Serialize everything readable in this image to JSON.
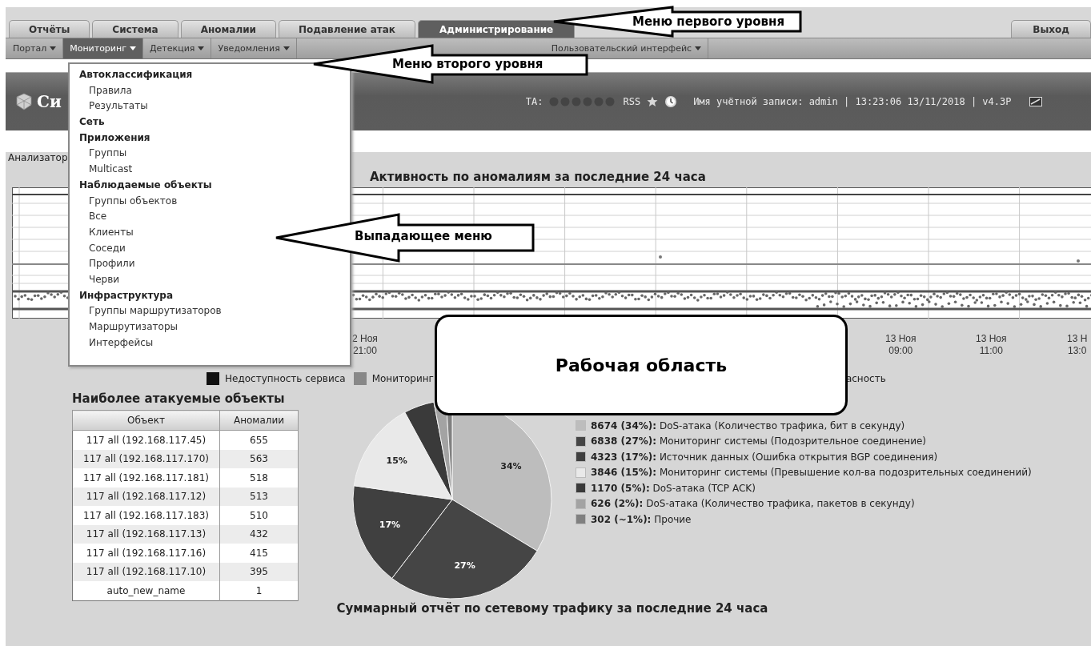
{
  "top_tabs": [
    {
      "label": "Отчёты",
      "selected": false
    },
    {
      "label": "Система",
      "selected": false
    },
    {
      "label": "Аномалии",
      "selected": false
    },
    {
      "label": "Подавление атак",
      "selected": false
    },
    {
      "label": "Администрирование",
      "selected": true
    }
  ],
  "logout": "Выход",
  "sub_menu": [
    {
      "label": "Портал",
      "selected": false
    },
    {
      "label": "Мониторинг",
      "selected": true
    },
    {
      "label": "Детекция",
      "selected": false
    },
    {
      "label": "Уведомления",
      "selected": false
    },
    {
      "label": "Пользовательский интерфейс",
      "selected": false
    }
  ],
  "dropdown": [
    {
      "label": "Автоклассификация",
      "children": [
        {
          "label": "Правила"
        },
        {
          "label": "Результаты"
        }
      ]
    },
    {
      "label": "Сеть"
    },
    {
      "label": "Приложения",
      "children": [
        {
          "label": "Группы"
        },
        {
          "label": "Multicast"
        }
      ]
    },
    {
      "label": "Наблюдаемые объекты",
      "children": [
        {
          "label": "Группы объектов"
        },
        {
          "label": "Все"
        },
        {
          "label": "Клиенты"
        },
        {
          "label": "Соседи"
        },
        {
          "label": "Профили"
        },
        {
          "label": "Черви"
        }
      ]
    },
    {
      "label": "Инфраструктура",
      "children": [
        {
          "label": "Группы маршрутизаторов"
        },
        {
          "label": "Маршрутизаторы"
        },
        {
          "label": "Интерфейсы"
        }
      ]
    }
  ],
  "header": {
    "title": "Си",
    "ta_label": "TA:",
    "rss": "RSS",
    "account": "Имя учётной записи: admin | 13:23:06 13/11/2018 | v4.3P"
  },
  "breadcrumb": "Анализатор",
  "activity": {
    "title": "Активность по аномалиям за последние 24 часа",
    "x_labels": [
      {
        "date": "2 Ноя",
        "time": "21:00"
      },
      {
        "date": "13 Ноя",
        "time": "09:00"
      },
      {
        "date": "13 Ноя",
        "time": "11:00"
      },
      {
        "date": "13 Н",
        "time": "13:0"
      }
    ],
    "legend": [
      {
        "label": "Недоступность сервиса",
        "color": "#111111"
      },
      {
        "label": "Мониторинг",
        "color": "#888888"
      },
      {
        "label": "асность"
      }
    ]
  },
  "top_objects": {
    "title": "Наиболее атакуемые объекты",
    "columns": [
      "Объект",
      "Аномалии"
    ],
    "rows": [
      [
        "117 all (192.168.117.45)",
        "655"
      ],
      [
        "117 all (192.168.117.170)",
        "563"
      ],
      [
        "117 all (192.168.117.181)",
        "518"
      ],
      [
        "117 all (192.168.117.12)",
        "513"
      ],
      [
        "117 all (192.168.117.183)",
        "510"
      ],
      [
        "117 all (192.168.117.13)",
        "432"
      ],
      [
        "117 all (192.168.117.16)",
        "415"
      ],
      [
        "117 all (192.168.117.10)",
        "395"
      ],
      [
        "auto_new_name",
        "1"
      ]
    ]
  },
  "anomaly_pie": {
    "chart_data": {
      "type": "pie",
      "categories": [
        "DoS-атака (Количество трафика, бит в секунду)",
        "Мониторинг системы (Подозрительное соединение)",
        "Источник данных (Ошибка открытия BGP соединения)",
        "Мониторинг системы (Превышение кол-ва подозрительных соединений)",
        "DoS-атака (TCP ACK)",
        "DoS-атака (Количество трафика, пакетов в секунду)",
        "Прочие"
      ],
      "values": [
        34,
        27,
        17,
        15,
        5,
        2,
        1
      ],
      "value_labels": [
        "34%",
        "27%",
        "17%",
        "15%",
        null,
        null,
        null
      ]
    },
    "legend": [
      {
        "value": "8674 (34%):",
        "color": "#bdbdbd"
      },
      {
        "value": "6838 (27%):",
        "color": "#454545"
      },
      {
        "value": "4323 (17%):",
        "color": "#404040"
      },
      {
        "value": "3846 (15%):",
        "color": "#e9e9e9"
      },
      {
        "value": "1170 (5%):",
        "color": "#3a3a3a"
      },
      {
        "value": "626 (2%):",
        "color": "#a3a3a3"
      },
      {
        "value": "302 (~1%):",
        "color": "#808080"
      }
    ]
  },
  "traffic_title": "Суммарный отчёт по сетевому трафику за последние 24 часа",
  "callouts": [
    {
      "kind": "arrow",
      "text": "Меню первого уровня"
    },
    {
      "kind": "arrow",
      "text": "Меню второго уровня"
    },
    {
      "kind": "arrow",
      "text": "Выпадающее меню"
    },
    {
      "kind": "box",
      "text": "Рабочая область"
    }
  ]
}
